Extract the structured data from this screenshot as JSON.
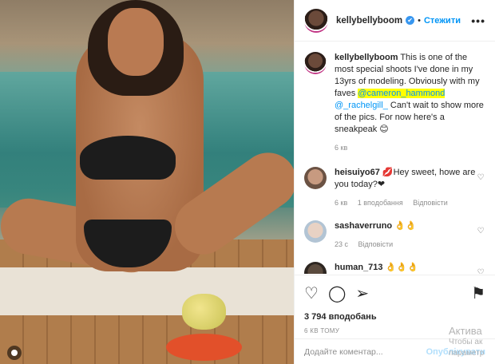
{
  "header": {
    "username": "kellybellyboom",
    "verified_icon": "✔",
    "dot": "•",
    "follow_label": "Стежити",
    "more_icon": "•••"
  },
  "caption": {
    "username": "kellybellyboom",
    "text_1": " This is one of the most special shoots I've done in my 13yrs of modeling. Obviously with my faves ",
    "mention_1": "@cameron_hammond",
    "text_2": " ",
    "mention_2": "@_rachelgill_",
    "text_3": " Can't wait to show more of the pics. For now here's a sneakpeak ",
    "emoji": "😊",
    "time": "6 кв"
  },
  "comments": [
    {
      "username": "heisuiyo67",
      "text": " 💋Hey sweet, howe are you today?❤",
      "time": "6 кв",
      "likes": "1 вподобання",
      "reply": "Відповісти"
    },
    {
      "username": "sashaverruno",
      "text": " 👌👌",
      "time": "23 с",
      "likes": "",
      "reply": "Відповісти"
    },
    {
      "username": "human_713",
      "text": " 👌👌👌",
      "time": "",
      "likes": "",
      "reply": ""
    }
  ],
  "actions": {
    "heart_icon": "♡",
    "comment_icon": "◯",
    "share_icon": "➢",
    "save_icon": "⚑",
    "likes_label": "3 794 вподобань",
    "time_ago": "6 КВ ТОМУ"
  },
  "add_comment": {
    "placeholder": "Додайте коментар...",
    "post_label": "Опублікувати"
  },
  "watermark": {
    "line1": "Актива",
    "line2": "Чтобы ак",
    "line3": "параметр"
  }
}
